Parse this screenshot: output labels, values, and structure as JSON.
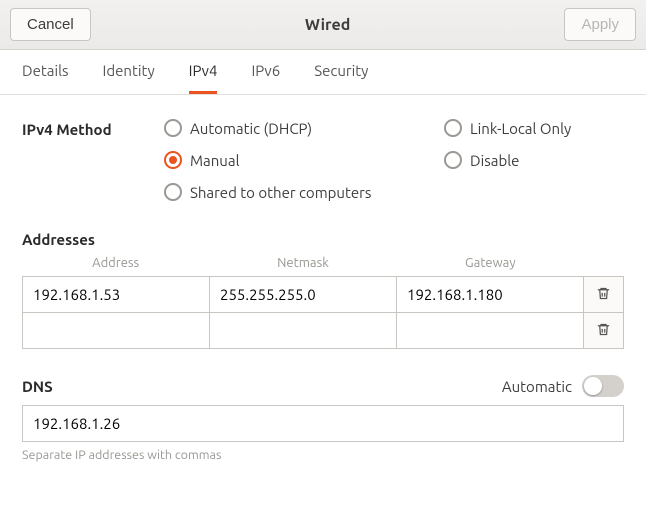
{
  "header": {
    "cancel": "Cancel",
    "title": "Wired",
    "apply": "Apply"
  },
  "tabs": {
    "details": "Details",
    "identity": "Identity",
    "ipv4": "IPv4",
    "ipv6": "IPv6",
    "security": "Security"
  },
  "ipv4": {
    "method_label": "IPv4 Method",
    "options": {
      "auto": "Automatic (DHCP)",
      "linklocal": "Link-Local Only",
      "manual": "Manual",
      "disable": "Disable",
      "shared": "Shared to other computers"
    },
    "selected": "manual"
  },
  "addresses": {
    "label": "Addresses",
    "headers": {
      "address": "Address",
      "netmask": "Netmask",
      "gateway": "Gateway"
    },
    "rows": [
      {
        "address": "192.168.1.53",
        "netmask": "255.255.255.0",
        "gateway": "192.168.1.180"
      },
      {
        "address": "",
        "netmask": "",
        "gateway": ""
      }
    ]
  },
  "dns": {
    "label": "DNS",
    "automatic_label": "Automatic",
    "automatic_on": false,
    "value": "192.168.1.26",
    "hint": "Separate IP addresses with commas"
  }
}
